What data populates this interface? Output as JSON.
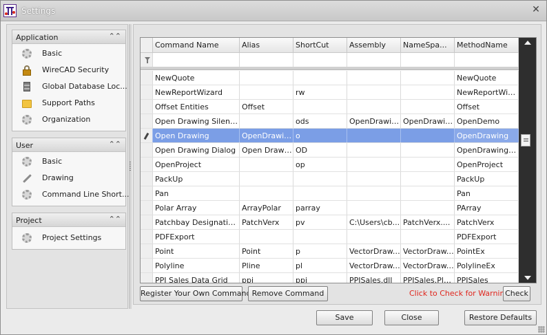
{
  "window": {
    "title": "Settings",
    "close_symbol": "✕"
  },
  "sidebar": {
    "groups": [
      {
        "label": "Application",
        "items": [
          "Basic",
          "WireCAD Security",
          "Global Database Loc...",
          "Support Paths",
          "Organization"
        ]
      },
      {
        "label": "User",
        "items": [
          "Basic",
          "Drawing",
          "Command Line Short..."
        ]
      },
      {
        "label": "Project",
        "items": [
          "Project Settings"
        ]
      }
    ],
    "collapse_symbol": "⌃⌃",
    "icons": {
      "application": [
        "gear-icon",
        "lock-icon",
        "database-icon",
        "folder-icon",
        "gear-icon"
      ],
      "user": [
        "gear-icon",
        "wrench-icon",
        "gear-icon"
      ],
      "project": [
        "gear-icon"
      ]
    }
  },
  "grid": {
    "columns": [
      "Command Name",
      "Alias",
      "ShortCut",
      "Assembly",
      "NameSpa...",
      "MethodName"
    ],
    "rows": [
      [
        "NewQuote",
        "",
        "",
        "",
        "",
        "NewQuote"
      ],
      [
        "NewReportWizard",
        "",
        "rw",
        "",
        "",
        "NewReportWiz..."
      ],
      [
        "Offset Entities",
        "Offset",
        "",
        "",
        "",
        "Offset"
      ],
      [
        "Open Drawing Silently ...",
        "",
        "ods",
        "OpenDrawin...",
        "OpenDrawin...",
        "OpenDemo"
      ],
      [
        "Open Drawing",
        "OpenDrawing",
        "o",
        "",
        "",
        "OpenDrawing"
      ],
      [
        "Open Drawing Dialog",
        "Open Drawi...",
        "OD",
        "",
        "",
        "OpenDrawingD..."
      ],
      [
        "OpenProject",
        "",
        "op",
        "",
        "",
        "OpenProject"
      ],
      [
        "PackUp",
        "",
        "",
        "",
        "",
        "PackUp"
      ],
      [
        "Pan",
        "",
        "",
        "",
        "",
        "Pan"
      ],
      [
        "Polar Array",
        "ArrayPolar",
        "parray",
        "",
        "",
        "PArray"
      ],
      [
        "Patchbay Designation ...",
        "PatchVerx",
        "pv",
        "C:\\Users\\cb...",
        "PatchVerx....",
        "PatchVerx"
      ],
      [
        "PDFExport",
        "",
        "",
        "",
        "",
        "PDFExport"
      ],
      [
        "Point",
        "Point",
        "p",
        "VectorDraw....",
        "VectorDraw....",
        "PointEx"
      ],
      [
        "Polyline",
        "Pline",
        "pl",
        "VectorDraw....",
        "VectorDraw....",
        "PolylineEx"
      ],
      [
        "PPI Sales Data Grid",
        "ppi",
        "ppi",
        "PPISales.dll",
        "PPISales.Plu...",
        "PPISales"
      ]
    ],
    "selected_row_index": 4
  },
  "actions": {
    "register": "Register Your Own Command",
    "remove": "Remove Command",
    "warnings": "Click to Check for Warnings",
    "check": "Check"
  },
  "footer": {
    "save": "Save",
    "close": "Close",
    "restore": "Restore Defaults"
  },
  "colors": {
    "selection": "#7b9ee6",
    "warning_text": "#e0261d",
    "scrollbar": "#2e2e2e"
  }
}
